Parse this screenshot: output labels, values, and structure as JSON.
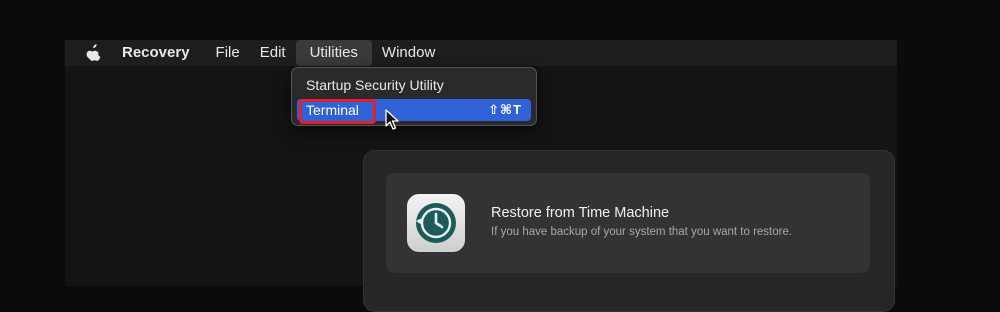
{
  "menubar": {
    "app_name": "Recovery",
    "items": [
      {
        "label": "File"
      },
      {
        "label": "Edit"
      },
      {
        "label": "Utilities",
        "active": true
      },
      {
        "label": "Window"
      }
    ]
  },
  "utilities_menu": {
    "items": [
      {
        "label": "Startup Security Utility",
        "shortcut": ""
      },
      {
        "label": "Terminal",
        "shortcut": "⇧⌘T",
        "selected": true
      }
    ]
  },
  "recovery_options": [
    {
      "icon": "time-machine-icon",
      "title": "Restore from Time Machine",
      "subtitle": "If you have backup of your system that you want to restore."
    }
  ],
  "colors": {
    "selection": "#2f62d9",
    "highlight_box": "#e0202a",
    "time_machine_teal": "#1d5a5a"
  }
}
